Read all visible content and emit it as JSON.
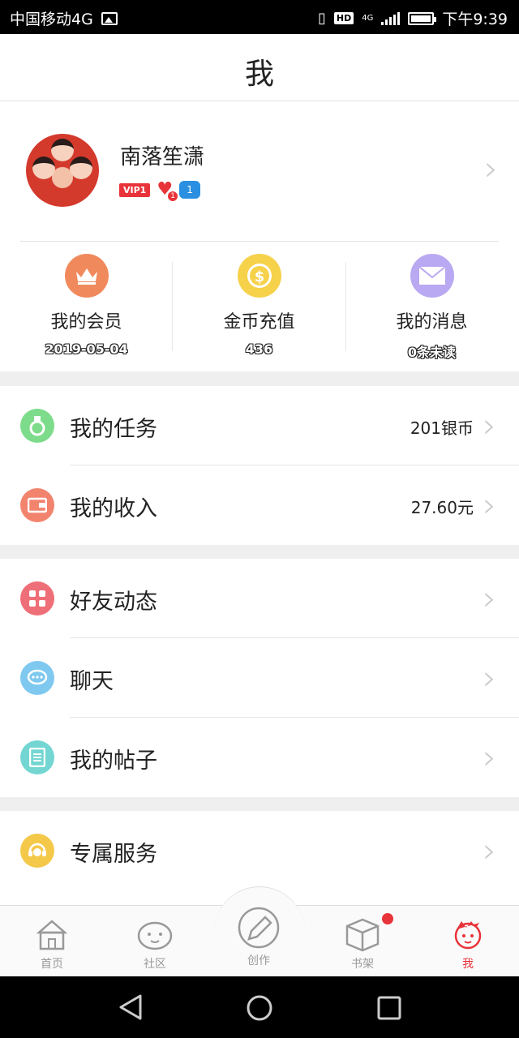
{
  "status_bar": {
    "carrier": "中国移动4G",
    "network": "4G",
    "hd": "HD",
    "time": "下午9:39"
  },
  "header": {
    "title": "我"
  },
  "profile": {
    "username": "南落笙潇",
    "vip_badge": "VIP1",
    "heart_badge_level": "1",
    "blue_badge_text": "1"
  },
  "stats": [
    {
      "label": "我的会员",
      "value": "2019-05-04",
      "icon": "crown-icon",
      "color": "#f08a5d"
    },
    {
      "label": "金币充值",
      "value": "436",
      "icon": "coin-icon",
      "color": "#f6d14a"
    },
    {
      "label": "我的消息",
      "value": "0条未读",
      "icon": "envelope-icon",
      "color": "#b9a8f2"
    }
  ],
  "group1": [
    {
      "label": "我的任务",
      "value": "201银币",
      "icon": "task-medal-icon",
      "color": "#7ddc8b"
    },
    {
      "label": "我的收入",
      "value": "27.60元",
      "icon": "wallet-icon",
      "color": "#f2846e"
    }
  ],
  "group2": [
    {
      "label": "好友动态",
      "icon": "grid-icon",
      "color": "#ef6f78"
    },
    {
      "label": "聊天",
      "icon": "chat-bubble-icon",
      "color": "#7fc9f0"
    },
    {
      "label": "我的帖子",
      "icon": "document-icon",
      "color": "#73d6d2"
    }
  ],
  "group3": [
    {
      "label": "专属服务",
      "icon": "headset-icon",
      "color": "#f4c94a"
    }
  ],
  "tabbar": {
    "home": "首页",
    "community": "社区",
    "create": "创作",
    "bookshelf": "书架",
    "me": "我",
    "active": "me",
    "active_color": "#e8333a"
  }
}
